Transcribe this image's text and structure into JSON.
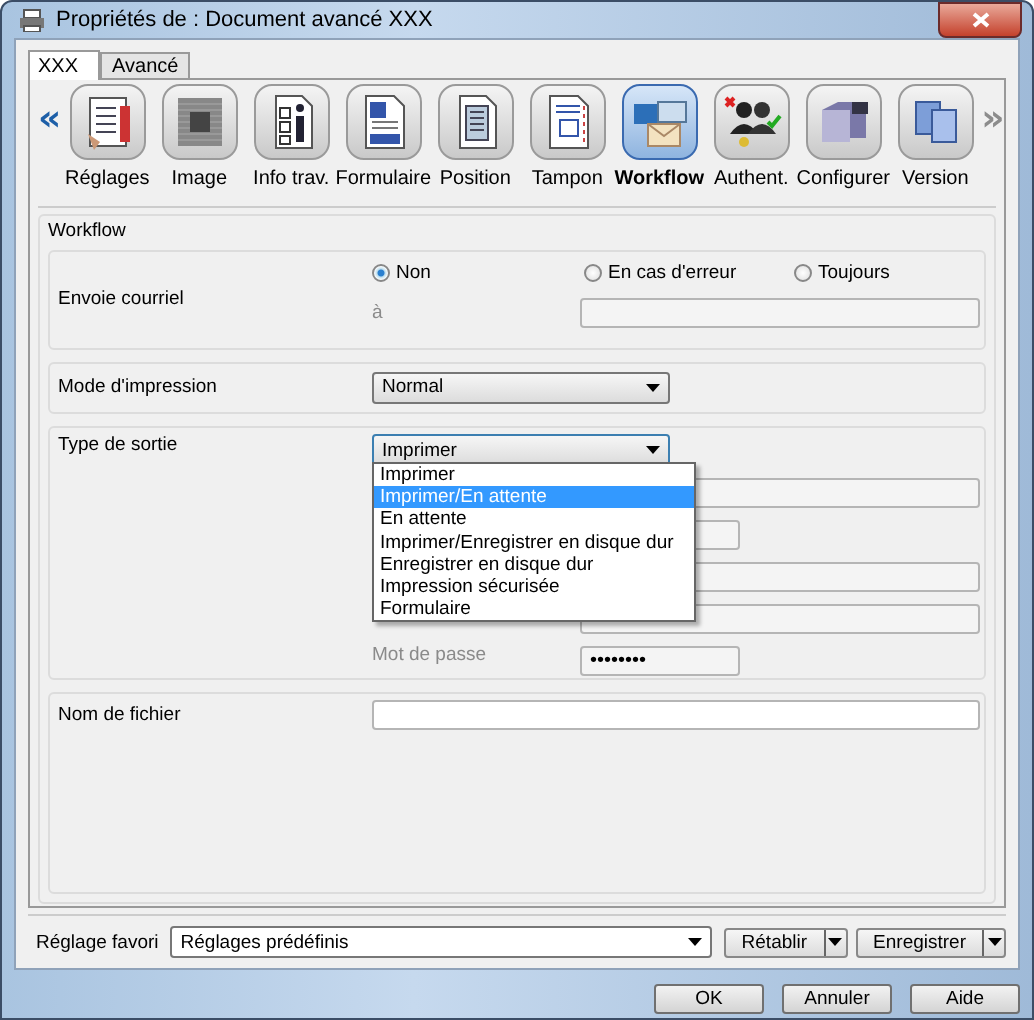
{
  "window": {
    "title": "Propriétés de : Document avancé XXX"
  },
  "tabs": [
    {
      "label": "XXX",
      "selected": true
    },
    {
      "label": "Avancé",
      "selected": false
    }
  ],
  "toolbar": {
    "scroll_left": {
      "glyph": "«",
      "disabled": false
    },
    "scroll_right": {
      "glyph": "»",
      "disabled": true
    },
    "items": [
      {
        "label": "Réglages",
        "selected": false
      },
      {
        "label": "Image",
        "selected": false
      },
      {
        "label": "Info trav.",
        "selected": false
      },
      {
        "label": "Formulaire",
        "selected": false
      },
      {
        "label": "Position",
        "selected": false
      },
      {
        "label": "Tampon",
        "selected": false
      },
      {
        "label": "Workflow",
        "selected": true
      },
      {
        "label": "Authent.",
        "selected": false
      },
      {
        "label": "Configurer",
        "selected": false
      },
      {
        "label": "Version",
        "selected": false
      }
    ]
  },
  "group": {
    "title": "Workflow"
  },
  "email": {
    "label": "Envoie courriel",
    "options": [
      {
        "label": "Non",
        "selected": true
      },
      {
        "label": "En cas d'erreur",
        "selected": false
      },
      {
        "label": "Toujours",
        "selected": false
      }
    ],
    "to_label": "à"
  },
  "print_mode": {
    "label": "Mode d'impression",
    "value": "Normal"
  },
  "output_type": {
    "label": "Type de sortie",
    "value": "Imprimer",
    "expanded": true,
    "options": [
      {
        "label": "Imprimer",
        "highlighted": false
      },
      {
        "label": "Imprimer/En attente",
        "highlighted": true
      },
      {
        "label": "En attente",
        "highlighted": false
      },
      {
        "label": "Imprimer/Enregistrer en disque dur",
        "highlighted": false
      },
      {
        "label": "Enregistrer en disque dur",
        "highlighted": false
      },
      {
        "label": "Impression sécurisée",
        "highlighted": false
      },
      {
        "label": "Formulaire",
        "highlighted": false
      }
    ],
    "password_label": "Mot de passe",
    "password": "••••••••"
  },
  "filename": {
    "label": "Nom de fichier"
  },
  "favorite": {
    "label": "Réglage favori",
    "value": "Réglages prédéfinis",
    "reset": "Rétablir",
    "save": "Enregistrer"
  },
  "buttons": [
    "OK",
    "Annuler",
    "Aide"
  ]
}
